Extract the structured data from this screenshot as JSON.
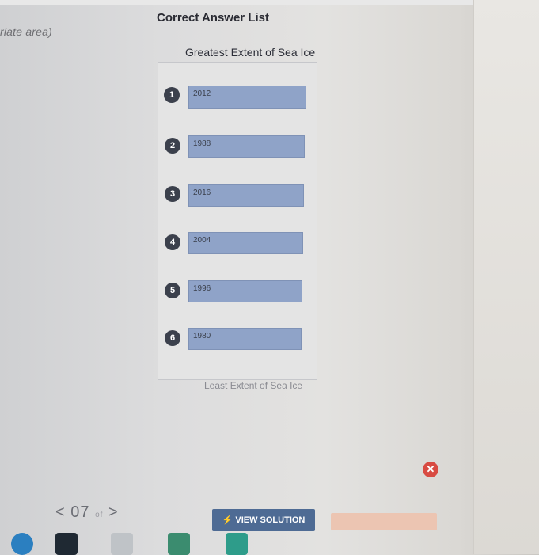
{
  "instructions_fragment": "riate area)",
  "panel": {
    "title": "Correct Answer List",
    "top_label": "Greatest Extent of Sea Ice",
    "bottom_label": "Least Extent of Sea Ice",
    "items": [
      {
        "rank": "1",
        "year": "2012"
      },
      {
        "rank": "2",
        "year": "1988"
      },
      {
        "rank": "3",
        "year": "2016"
      },
      {
        "rank": "4",
        "year": "2004"
      },
      {
        "rank": "5",
        "year": "1996"
      },
      {
        "rank": "6",
        "year": "1980"
      }
    ]
  },
  "close_button": {
    "label": "✕"
  },
  "pager": {
    "prev": "<",
    "current": "07",
    "of": "of",
    "next": ">"
  },
  "view_solution_button": {
    "label": "VIEW SOLUTION",
    "icon": "lightning-icon"
  },
  "colors": {
    "answer_fill": "#8fa3c8",
    "number_badge": "#3b404c",
    "close": "#d84b42",
    "view_button": "#4e6b94",
    "disabled_button": "#ecc5b2"
  }
}
